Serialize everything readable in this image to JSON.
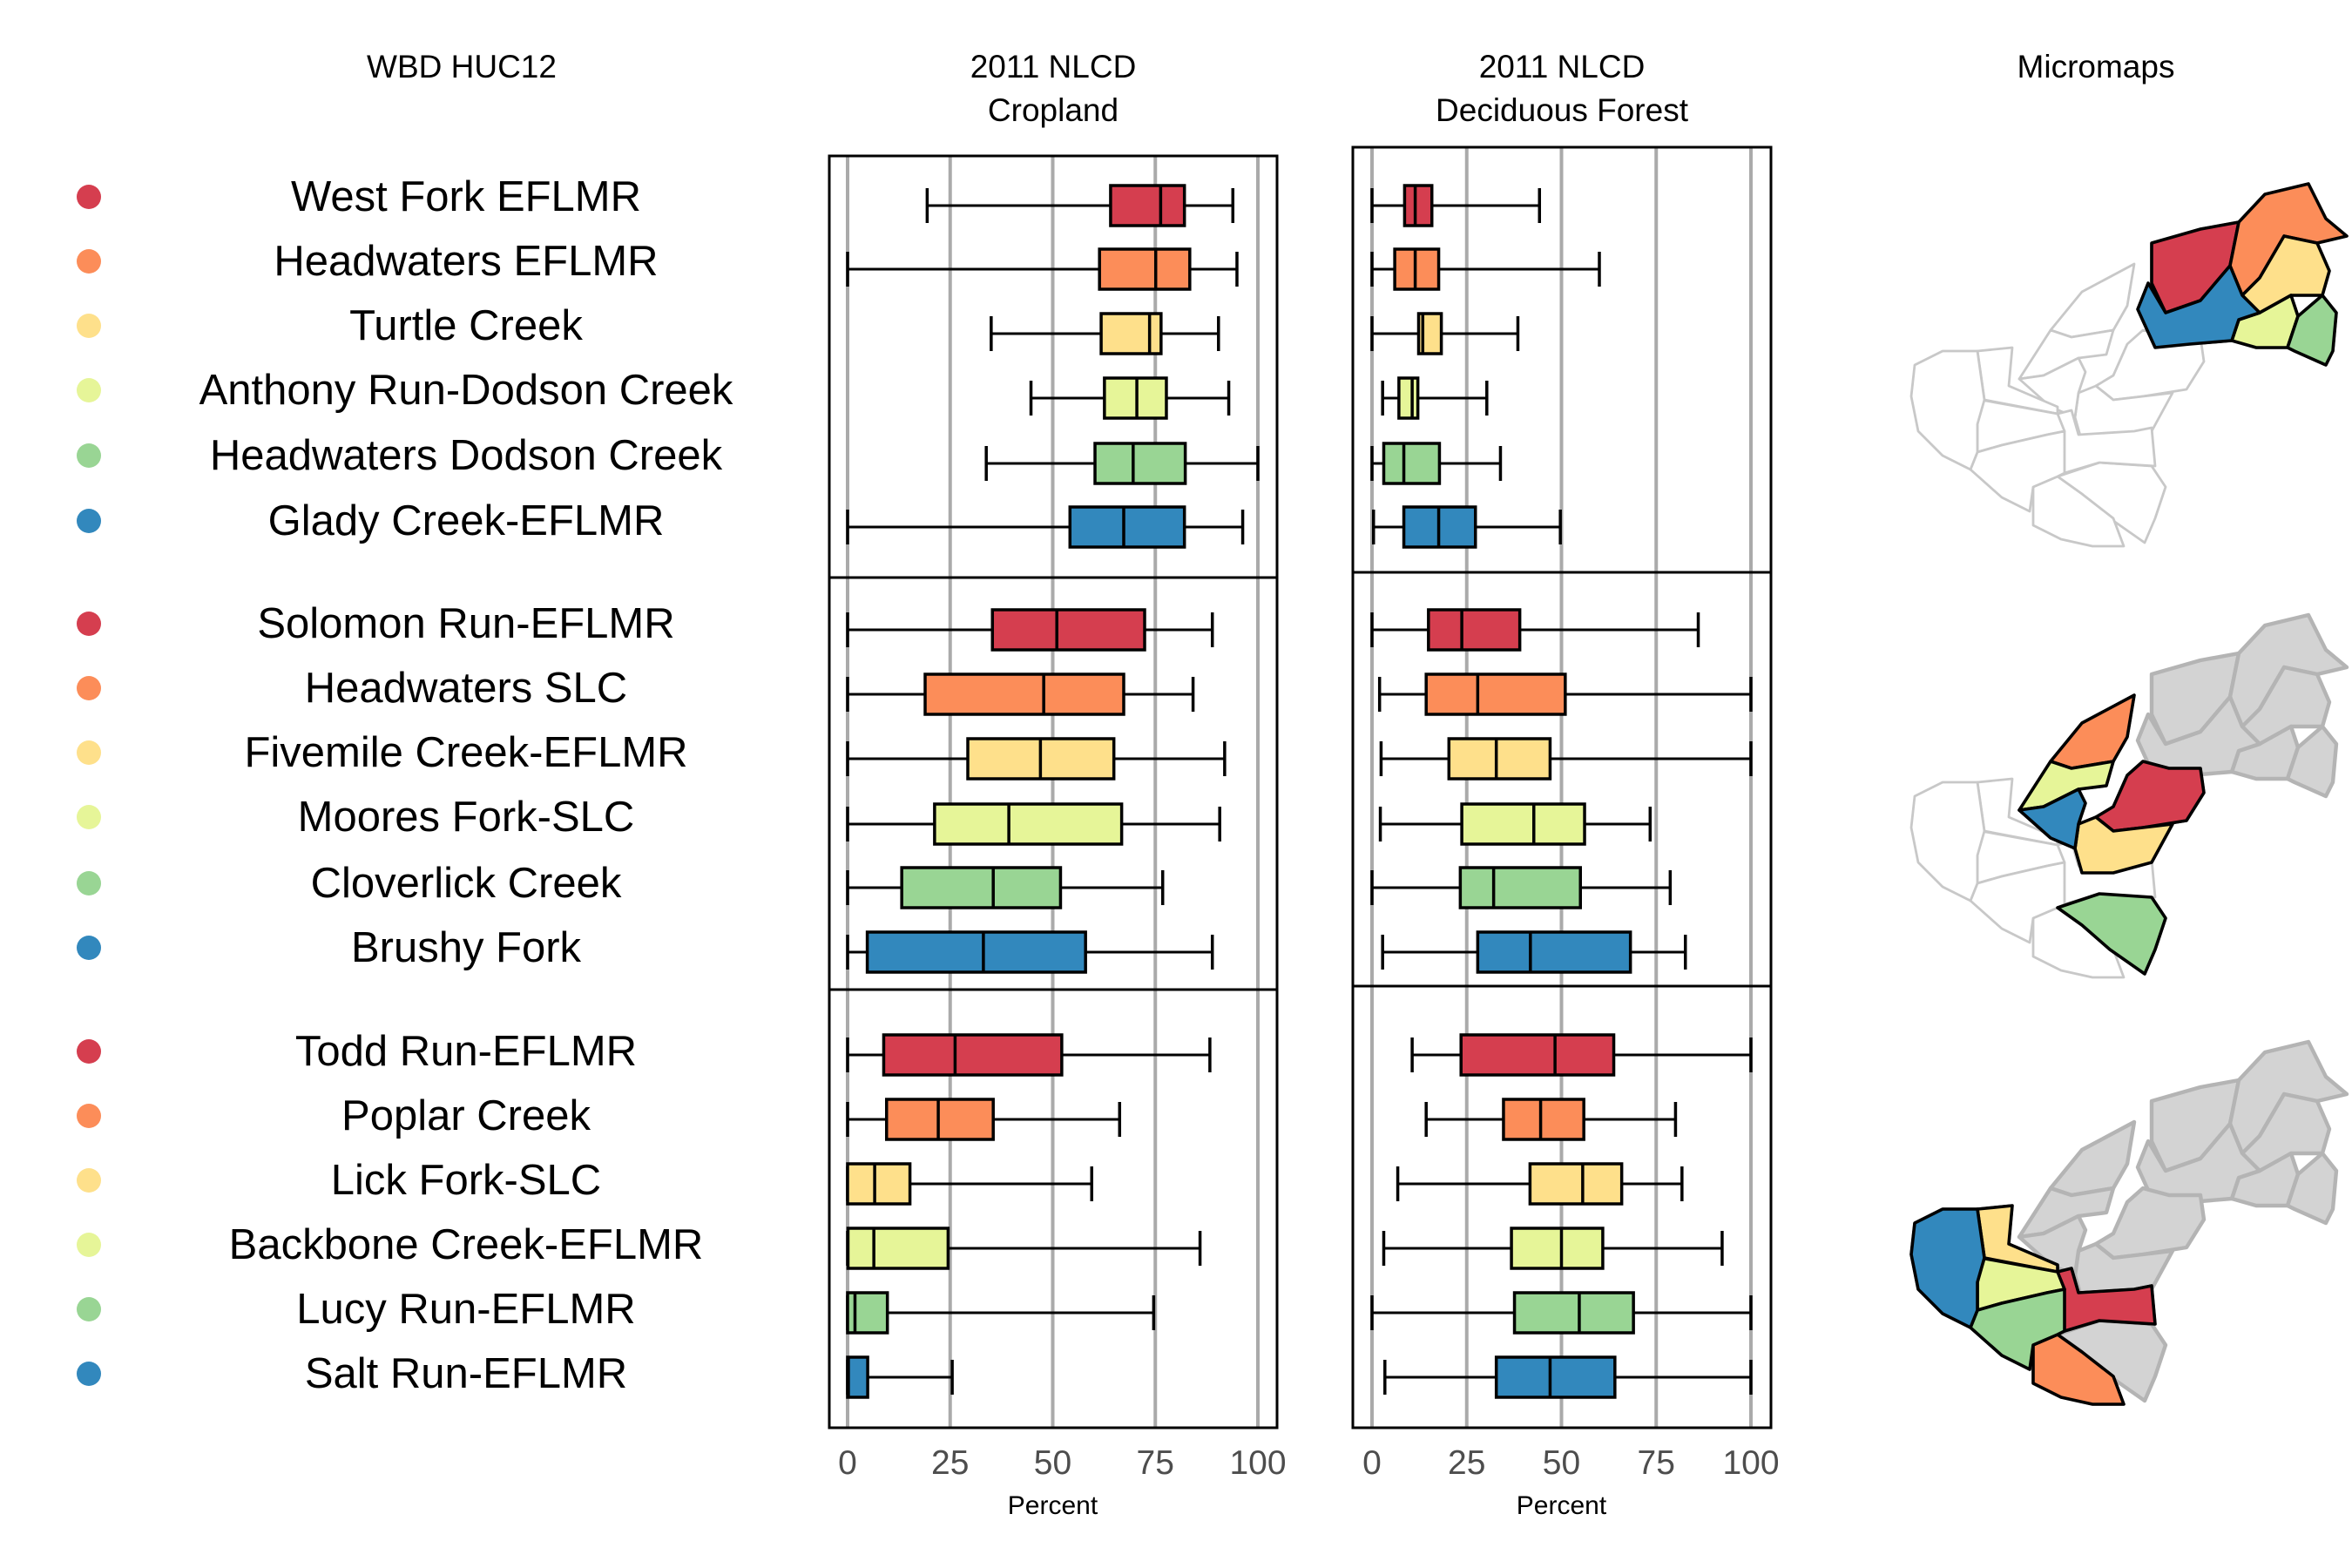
{
  "titles": {
    "labels": "WBD HUC12",
    "cropland_line1": "2011 NLCD",
    "cropland_line2": "Cropland",
    "forest_line1": "2011 NLCD",
    "forest_line2": "Deciduous Forest",
    "maps": "Micromaps"
  },
  "palette": [
    "#d53e4f",
    "#fc8d59",
    "#fee08b",
    "#e6f598",
    "#99d594",
    "#3288bd"
  ],
  "colors": {
    "grid": "#aaaaaa",
    "tick_text": "#4d4d4d",
    "map_outline": "#c8c8c8",
    "map_done": "#d3d3d3",
    "map_done_edge": "#b4b4b4"
  },
  "chart_data": [
    {
      "type": "boxplot",
      "title": "2011 NLCD Cropland",
      "xlabel": "Percent",
      "xlim": [
        0,
        100
      ],
      "xticks": [
        "0",
        "25",
        "50",
        "75",
        "100"
      ],
      "grid": true,
      "groups": [
        {
          "rows": [
            {
              "name": "West Fork EFLMR",
              "min": 19.4,
              "q1": 64.1,
              "median": 76.3,
              "q3": 82.1,
              "max": 93.9
            },
            {
              "name": "Headwaters EFLMR",
              "min": 0,
              "q1": 61.4,
              "median": 75.1,
              "q3": 83.4,
              "max": 94.9
            },
            {
              "name": "Turtle Creek",
              "min": 35.0,
              "q1": 61.8,
              "median": 73.6,
              "q3": 76.4,
              "max": 90.4
            },
            {
              "name": "Anthony Run-Dodson Creek",
              "min": 44.7,
              "q1": 62.6,
              "median": 70.5,
              "q3": 77.7,
              "max": 92.9
            },
            {
              "name": "Headwaters Dodson Creek",
              "min": 33.8,
              "q1": 60.3,
              "median": 69.6,
              "q3": 82.3,
              "max": 100
            },
            {
              "name": "Glady Creek-EFLMR",
              "min": 0,
              "q1": 54.2,
              "median": 67.3,
              "q3": 82.1,
              "max": 96.3
            }
          ]
        },
        {
          "rows": [
            {
              "name": "Solomon Run-EFLMR",
              "min": 0,
              "q1": 35.3,
              "median": 51.0,
              "q3": 72.4,
              "max": 88.9
            },
            {
              "name": "Headwaters SLC",
              "min": 0,
              "q1": 18.9,
              "median": 47.8,
              "q3": 67.3,
              "max": 84.2
            },
            {
              "name": "Fivemile Creek-EFLMR",
              "min": 0,
              "q1": 29.3,
              "median": 47.0,
              "q3": 64.9,
              "max": 91.9
            },
            {
              "name": "Moores Fork-SLC",
              "min": 0,
              "q1": 21.2,
              "median": 39.3,
              "q3": 66.8,
              "max": 90.7
            },
            {
              "name": "Cloverlick Creek",
              "min": 0,
              "q1": 13.2,
              "median": 35.5,
              "q3": 51.9,
              "max": 76.8
            },
            {
              "name": "Brushy Fork",
              "min": 0,
              "q1": 4.8,
              "median": 33.1,
              "q3": 58.0,
              "max": 88.9
            }
          ]
        },
        {
          "rows": [
            {
              "name": "Todd Run-EFLMR",
              "min": 0,
              "q1": 8.8,
              "median": 26.2,
              "q3": 52.2,
              "max": 88.3
            },
            {
              "name": "Poplar Creek",
              "min": 0,
              "q1": 9.5,
              "median": 22.1,
              "q3": 35.5,
              "max": 66.3
            },
            {
              "name": "Lick Fork-SLC",
              "min": 0,
              "q1": 0,
              "median": 6.6,
              "q3": 15.2,
              "max": 59.5
            },
            {
              "name": "Backbone Creek-EFLMR",
              "min": 0,
              "q1": 0.1,
              "median": 6.4,
              "q3": 24.5,
              "max": 85.9
            },
            {
              "name": "Lucy Run-EFLMR",
              "min": 0,
              "q1": 0,
              "median": 1.8,
              "q3": 9.7,
              "max": 74.6
            },
            {
              "name": "Salt Run-EFLMR",
              "min": 0,
              "q1": 0,
              "median": 0.2,
              "q3": 4.9,
              "max": 25.5
            }
          ]
        }
      ]
    },
    {
      "type": "boxplot",
      "title": "2011 NLCD Deciduous Forest",
      "xlabel": "Percent",
      "xlim": [
        0,
        100
      ],
      "xticks": [
        "0",
        "25",
        "50",
        "75",
        "100"
      ],
      "grid": true,
      "groups": [
        {
          "rows": [
            {
              "name": "West Fork EFLMR",
              "min": 0,
              "q1": 8.6,
              "median": 11.4,
              "q3": 15.8,
              "max": 44.2
            },
            {
              "name": "Headwaters EFLMR",
              "min": 0,
              "q1": 6.0,
              "median": 11.4,
              "q3": 17.6,
              "max": 60.0
            },
            {
              "name": "Turtle Creek",
              "min": 0,
              "q1": 12.3,
              "median": 13.4,
              "q3": 18.3,
              "max": 38.5
            },
            {
              "name": "Anthony Run-Dodson Creek",
              "min": 2.8,
              "q1": 7.1,
              "median": 10.6,
              "q3": 12.1,
              "max": 30.3
            },
            {
              "name": "Headwaters Dodson Creek",
              "min": 0,
              "q1": 3.1,
              "median": 8.4,
              "q3": 17.8,
              "max": 33.9
            },
            {
              "name": "Glady Creek-EFLMR",
              "min": 0.4,
              "q1": 8.4,
              "median": 17.6,
              "q3": 27.3,
              "max": 49.7
            }
          ]
        },
        {
          "rows": [
            {
              "name": "Solomon Run-EFLMR",
              "min": 0,
              "q1": 14.9,
              "median": 23.7,
              "q3": 39.0,
              "max": 86.1
            },
            {
              "name": "Headwaters SLC",
              "min": 2.0,
              "q1": 14.3,
              "median": 27.9,
              "q3": 51.0,
              "max": 100
            },
            {
              "name": "Fivemile Creek-EFLMR",
              "min": 2.4,
              "q1": 20.3,
              "median": 32.8,
              "q3": 47.0,
              "max": 100
            },
            {
              "name": "Moores Fork-SLC",
              "min": 2.2,
              "q1": 23.7,
              "median": 42.7,
              "q3": 56.1,
              "max": 73.4
            },
            {
              "name": "Cloverlick Creek",
              "min": 0,
              "q1": 23.3,
              "median": 32.1,
              "q3": 55.0,
              "max": 78.7
            },
            {
              "name": "Brushy Fork",
              "min": 2.8,
              "q1": 27.9,
              "median": 41.8,
              "q3": 68.2,
              "max": 82.7
            }
          ]
        },
        {
          "rows": [
            {
              "name": "Todd Run-EFLMR",
              "min": 10.6,
              "q1": 23.5,
              "median": 48.3,
              "q3": 63.8,
              "max": 100
            },
            {
              "name": "Poplar Creek",
              "min": 14.3,
              "q1": 34.7,
              "median": 44.5,
              "q3": 55.9,
              "max": 80.1
            },
            {
              "name": "Lick Fork-SLC",
              "min": 6.8,
              "q1": 41.7,
              "median": 55.6,
              "q3": 65.9,
              "max": 81.8
            },
            {
              "name": "Backbone Creek-EFLMR",
              "min": 3.1,
              "q1": 36.8,
              "median": 50.0,
              "q3": 60.9,
              "max": 92.4
            },
            {
              "name": "Lucy Run-EFLMR",
              "min": 0,
              "q1": 37.6,
              "median": 54.7,
              "q3": 69.0,
              "max": 100
            },
            {
              "name": "Salt Run-EFLMR",
              "min": 3.4,
              "q1": 32.8,
              "median": 47.0,
              "q3": 64.1,
              "max": 100
            }
          ]
        }
      ]
    }
  ],
  "labels": {
    "groups": [
      [
        "West Fork EFLMR",
        "Headwaters EFLMR",
        "Turtle Creek",
        "Anthony Run-Dodson Creek",
        "Headwaters Dodson Creek",
        "Glady Creek-EFLMR"
      ],
      [
        "Solomon Run-EFLMR",
        "Headwaters SLC",
        "Fivemile Creek-EFLMR",
        "Moores Fork-SLC",
        "Cloverlick Creek",
        "Brushy Fork"
      ],
      [
        "Todd Run-EFLMR",
        "Poplar Creek",
        "Lick Fork-SLC",
        "Backbone Creek-EFLMR",
        "Lucy Run-EFLMR",
        "Salt Run-EFLMR"
      ]
    ]
  },
  "micromaps": [
    {
      "highlighted": [
        "West Fork EFLMR",
        "Headwaters EFLMR",
        "Turtle Creek",
        "Anthony Run-Dodson Creek",
        "Headwaters Dodson Creek",
        "Glady Creek-EFLMR"
      ],
      "previously_shown": "none"
    },
    {
      "highlighted": [
        "Solomon Run-EFLMR",
        "Headwaters SLC",
        "Fivemile Creek-EFLMR",
        "Moores Fork-SLC",
        "Cloverlick Creek",
        "Brushy Fork"
      ],
      "previously_shown": "group 1"
    },
    {
      "highlighted": [
        "Todd Run-EFLMR",
        "Poplar Creek",
        "Lick Fork-SLC",
        "Backbone Creek-EFLMR",
        "Lucy Run-EFLMR",
        "Salt Run-EFLMR"
      ],
      "previously_shown": "groups 1-2"
    }
  ]
}
